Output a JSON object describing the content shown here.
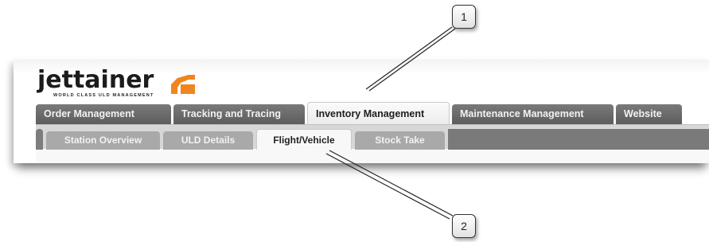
{
  "app": {
    "logo_word": "jettainer",
    "logo_tagline": "WORLD CLASS ULD MANAGEMENT"
  },
  "main_tabs": [
    {
      "label": "Order Management",
      "active": false
    },
    {
      "label": "Tracking and Tracing",
      "active": false
    },
    {
      "label": "Inventory Management",
      "active": true
    },
    {
      "label": "Maintenance Management",
      "active": false
    },
    {
      "label": "Website",
      "active": false
    }
  ],
  "sub_tabs": [
    {
      "label": "Station Overview",
      "active": false
    },
    {
      "label": "ULD Details",
      "active": false
    },
    {
      "label": "Flight/Vehicle",
      "active": true
    },
    {
      "label": "Stock Take",
      "active": false
    }
  ],
  "callouts": [
    {
      "number": "1"
    },
    {
      "number": "2"
    }
  ],
  "colors": {
    "brand_accent": "#f0851f",
    "tab_inactive": "#666666",
    "tab_active": "#f5f5f5"
  }
}
